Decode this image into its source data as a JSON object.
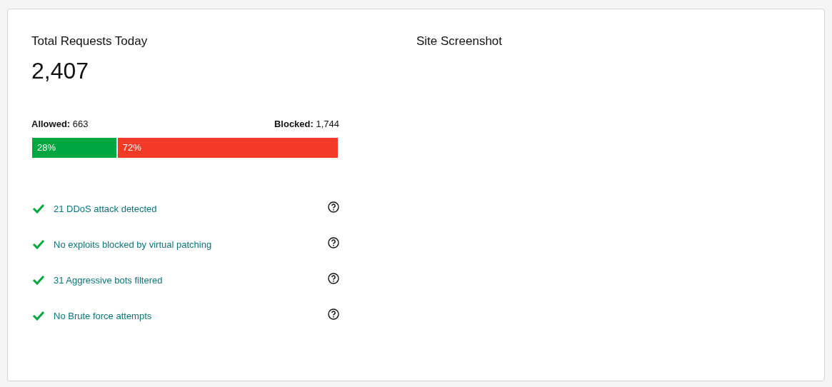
{
  "requests": {
    "title": "Total Requests Today",
    "total": "2,407",
    "allowed": "**Allowed:** 663",
    "blocked": "**Blocked:** 1,744",
    "bar": {
      "level": 0.28,
      "allowed_percent": "28%",
      "blocked_percent": "72%"
    }
  },
  "checks": [
    {
      "text": "21 DDoS attack detected"
    },
    {
      "text": "No exploits blocked by virtual patching"
    },
    {
      "text": "31 Aggressive bots filtered"
    },
    {
      "text": "No Brute force attempts"
    }
  ],
  "screenshot": {
    "title": "Site Screenshot"
  }
}
